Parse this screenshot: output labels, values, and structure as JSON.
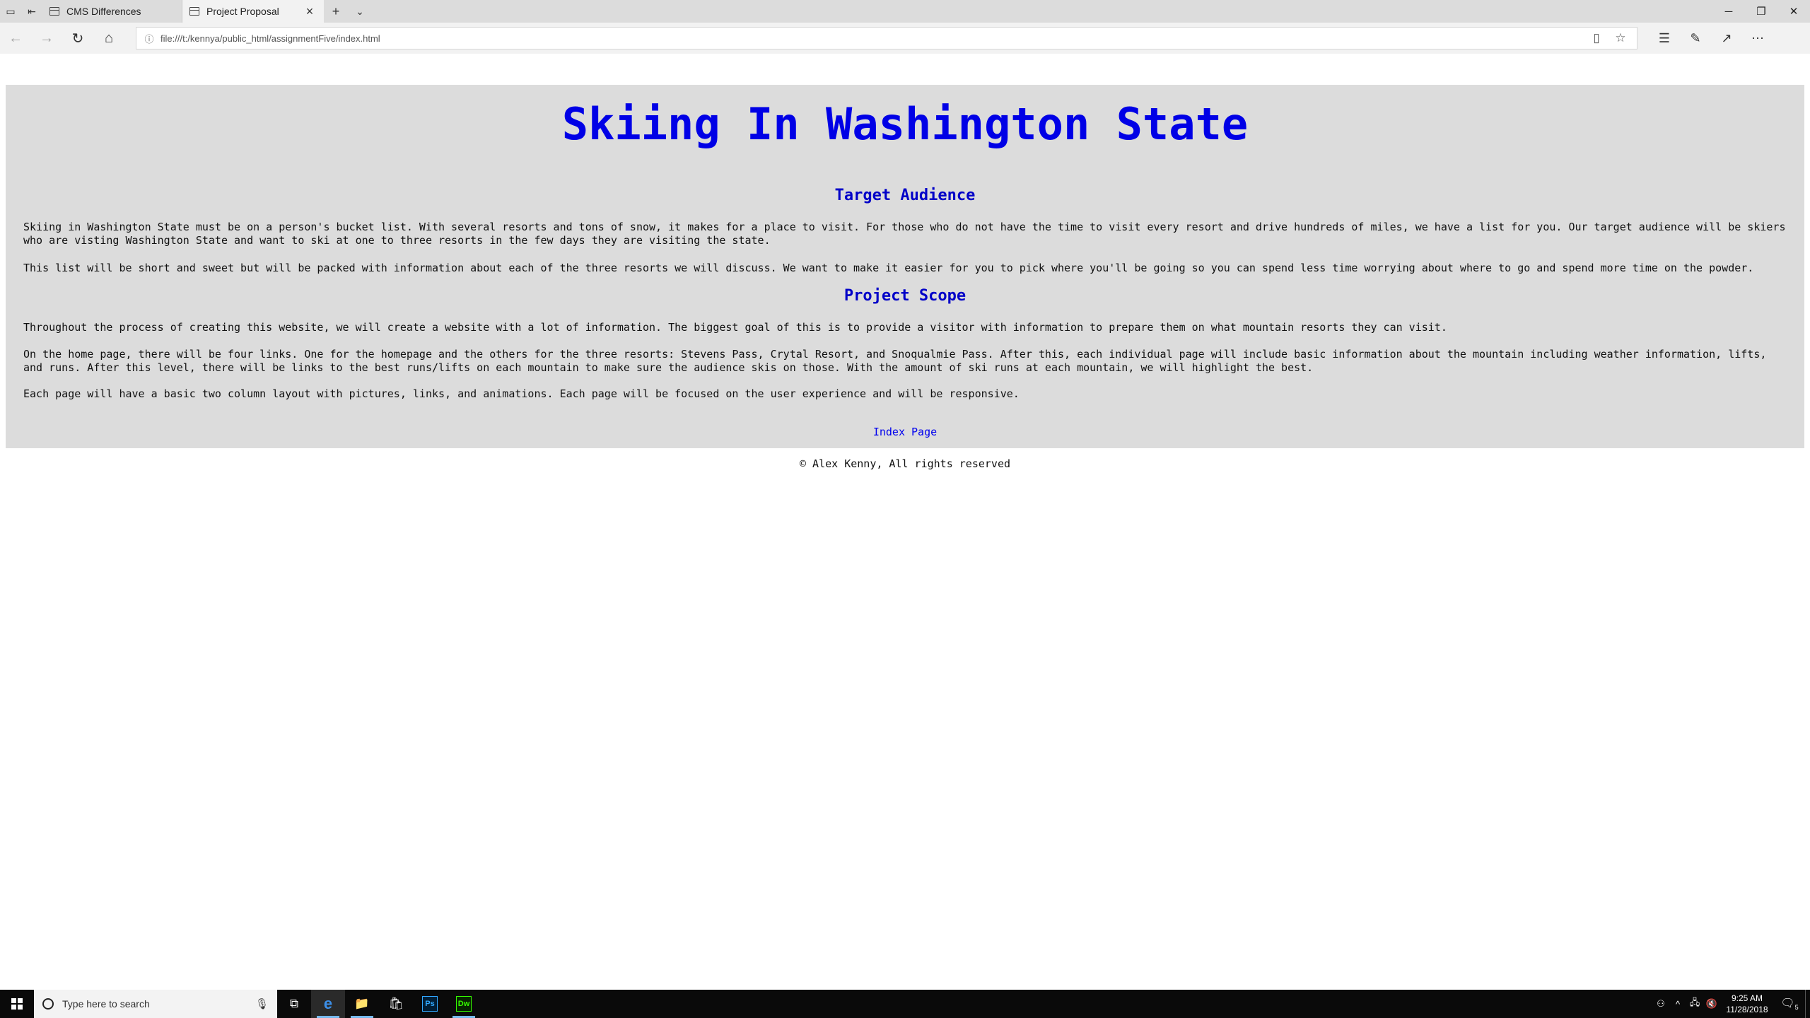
{
  "browser": {
    "tabs": [
      {
        "label": "CMS Differences",
        "active": false
      },
      {
        "label": "Project Proposal",
        "active": true
      }
    ],
    "address_url": "file:///t:/kennya/public_html/assignmentFive/index.html"
  },
  "page": {
    "title": "Skiing In Washington State",
    "sections": [
      {
        "heading": "Target Audience",
        "paragraphs": [
          "Skiing in Washington State must be on a person's bucket list. With several resorts and tons of snow, it makes for a place to visit. For those who do not have the time to visit every resort and drive hundreds of miles, we have a list for you. Our target audience will be skiers who are visting Washington State and want to ski at one to three resorts in the few days they are visiting the state.",
          "This list will be short and sweet but will be packed with information about each of the three resorts we will discuss. We want to make it easier for you to pick where you'll be going so you can spend less time worrying about where to go and spend more time on the powder."
        ]
      },
      {
        "heading": "Project Scope",
        "paragraphs": [
          "Throughout the process of creating this website, we will create a website with a lot of information. The biggest goal of this is to provide a visitor with information to prepare them on what mountain resorts they can visit.",
          "On the home page, there will be four links. One for the homepage and the others for the three resorts: Stevens Pass, Crytal Resort, and Snoqualmie Pass. After this, each individual page will include basic information about the mountain including weather information, lifts, and runs. After this level, there will be links to the best runs/lifts on each mountain to make sure the audience skis on those. With the amount of ski runs at each mountain, we will highlight the best.",
          "Each page will have a basic two column layout with pictures, links, and animations. Each page will be focused on the user experience and will be responsive."
        ]
      }
    ],
    "index_link": "Index Page",
    "footer": "© Alex Kenny, All rights reserved"
  },
  "taskbar": {
    "search_placeholder": "Type here to search",
    "time": "9:25 AM",
    "date": "11/28/2018",
    "apps": [
      "edge-icon",
      "file-explorer-icon",
      "store-icon",
      "photoshop-icon",
      "dreamweaver-icon"
    ],
    "ps_label": "Ps",
    "dw_label": "Dw",
    "notification_count": "5"
  },
  "colors": {
    "heading": "#0000e6",
    "page_background": "#dcdcdc",
    "link": "#0000ee"
  }
}
